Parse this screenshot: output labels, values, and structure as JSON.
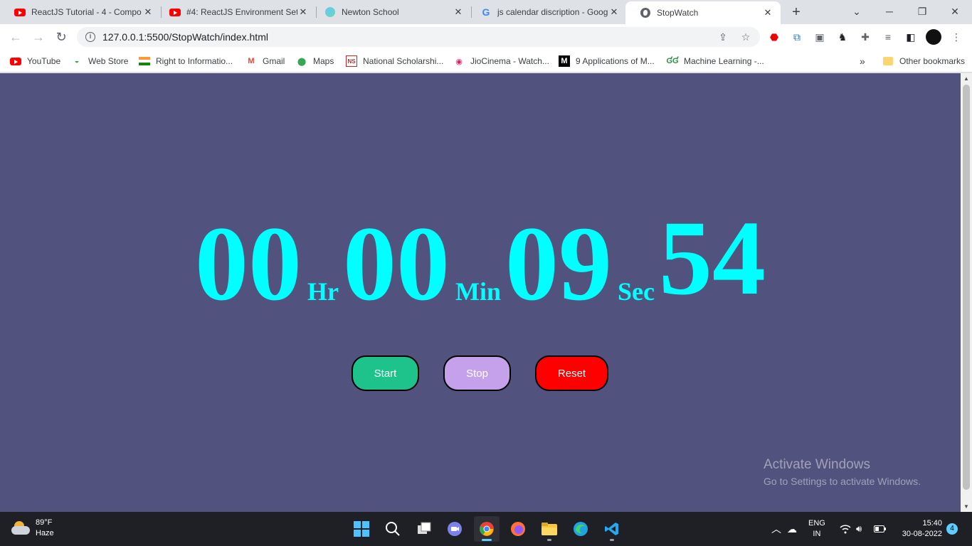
{
  "browser": {
    "tabs": [
      {
        "title": "ReactJS Tutorial - 4 - Compo",
        "icon": "youtube-icon"
      },
      {
        "title": "#4: ReactJS Environment Setu",
        "icon": "youtube-icon"
      },
      {
        "title": "Newton School",
        "icon": "newton-school-icon"
      },
      {
        "title": "js calendar discription - Goog",
        "icon": "google-icon"
      },
      {
        "title": "StopWatch",
        "icon": "globe-icon",
        "active": true
      }
    ],
    "address": "127.0.0.1:5500/StopWatch/index.html",
    "bookmarks": [
      {
        "label": "YouTube"
      },
      {
        "label": "Web Store"
      },
      {
        "label": "Right to Informatio..."
      },
      {
        "label": "Gmail"
      },
      {
        "label": "Maps"
      },
      {
        "label": "National Scholarshi..."
      },
      {
        "label": "JioCinema - Watch..."
      },
      {
        "label": "9 Applications of M..."
      },
      {
        "label": "Machine Learning -..."
      }
    ],
    "overflow": "»",
    "other_bookmarks": "Other bookmarks"
  },
  "stopwatch": {
    "hours": "00",
    "hours_unit": "Hr",
    "minutes": "00",
    "minutes_unit": "Min",
    "seconds": "09",
    "seconds_unit": "Sec",
    "centiseconds": "54",
    "buttons": {
      "start": "Start",
      "stop": "Stop",
      "reset": "Reset"
    },
    "colors": {
      "background": "#52527f",
      "digits": "#00ffff",
      "start": "#1ec38b",
      "stop": "#c5a1ec",
      "reset": "#ff0000"
    }
  },
  "watermark": {
    "line1": "Activate Windows",
    "line2": "Go to Settings to activate Windows."
  },
  "taskbar": {
    "temperature": "89°F",
    "condition": "Haze",
    "language": "ENG",
    "region": "IN",
    "time": "15:40",
    "date": "30-08-2022",
    "notifications": "4"
  }
}
